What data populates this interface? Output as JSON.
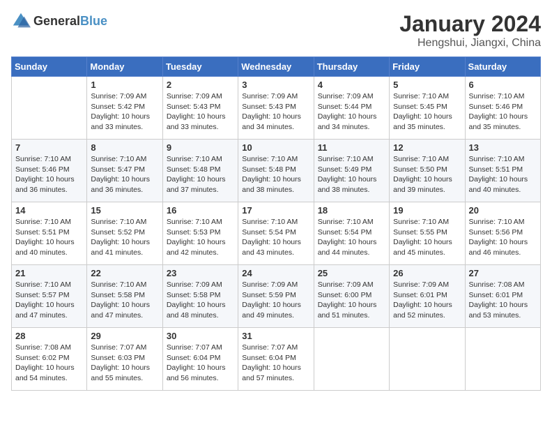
{
  "header": {
    "logo_general": "General",
    "logo_blue": "Blue",
    "title": "January 2024",
    "subtitle": "Hengshui, Jiangxi, China"
  },
  "calendar": {
    "days_of_week": [
      "Sunday",
      "Monday",
      "Tuesday",
      "Wednesday",
      "Thursday",
      "Friday",
      "Saturday"
    ],
    "weeks": [
      [
        {
          "day": "",
          "info": ""
        },
        {
          "day": "1",
          "info": "Sunrise: 7:09 AM\nSunset: 5:42 PM\nDaylight: 10 hours\nand 33 minutes."
        },
        {
          "day": "2",
          "info": "Sunrise: 7:09 AM\nSunset: 5:43 PM\nDaylight: 10 hours\nand 33 minutes."
        },
        {
          "day": "3",
          "info": "Sunrise: 7:09 AM\nSunset: 5:43 PM\nDaylight: 10 hours\nand 34 minutes."
        },
        {
          "day": "4",
          "info": "Sunrise: 7:09 AM\nSunset: 5:44 PM\nDaylight: 10 hours\nand 34 minutes."
        },
        {
          "day": "5",
          "info": "Sunrise: 7:10 AM\nSunset: 5:45 PM\nDaylight: 10 hours\nand 35 minutes."
        },
        {
          "day": "6",
          "info": "Sunrise: 7:10 AM\nSunset: 5:46 PM\nDaylight: 10 hours\nand 35 minutes."
        }
      ],
      [
        {
          "day": "7",
          "info": "Sunrise: 7:10 AM\nSunset: 5:46 PM\nDaylight: 10 hours\nand 36 minutes."
        },
        {
          "day": "8",
          "info": "Sunrise: 7:10 AM\nSunset: 5:47 PM\nDaylight: 10 hours\nand 36 minutes."
        },
        {
          "day": "9",
          "info": "Sunrise: 7:10 AM\nSunset: 5:48 PM\nDaylight: 10 hours\nand 37 minutes."
        },
        {
          "day": "10",
          "info": "Sunrise: 7:10 AM\nSunset: 5:48 PM\nDaylight: 10 hours\nand 38 minutes."
        },
        {
          "day": "11",
          "info": "Sunrise: 7:10 AM\nSunset: 5:49 PM\nDaylight: 10 hours\nand 38 minutes."
        },
        {
          "day": "12",
          "info": "Sunrise: 7:10 AM\nSunset: 5:50 PM\nDaylight: 10 hours\nand 39 minutes."
        },
        {
          "day": "13",
          "info": "Sunrise: 7:10 AM\nSunset: 5:51 PM\nDaylight: 10 hours\nand 40 minutes."
        }
      ],
      [
        {
          "day": "14",
          "info": "Sunrise: 7:10 AM\nSunset: 5:51 PM\nDaylight: 10 hours\nand 40 minutes."
        },
        {
          "day": "15",
          "info": "Sunrise: 7:10 AM\nSunset: 5:52 PM\nDaylight: 10 hours\nand 41 minutes."
        },
        {
          "day": "16",
          "info": "Sunrise: 7:10 AM\nSunset: 5:53 PM\nDaylight: 10 hours\nand 42 minutes."
        },
        {
          "day": "17",
          "info": "Sunrise: 7:10 AM\nSunset: 5:54 PM\nDaylight: 10 hours\nand 43 minutes."
        },
        {
          "day": "18",
          "info": "Sunrise: 7:10 AM\nSunset: 5:54 PM\nDaylight: 10 hours\nand 44 minutes."
        },
        {
          "day": "19",
          "info": "Sunrise: 7:10 AM\nSunset: 5:55 PM\nDaylight: 10 hours\nand 45 minutes."
        },
        {
          "day": "20",
          "info": "Sunrise: 7:10 AM\nSunset: 5:56 PM\nDaylight: 10 hours\nand 46 minutes."
        }
      ],
      [
        {
          "day": "21",
          "info": "Sunrise: 7:10 AM\nSunset: 5:57 PM\nDaylight: 10 hours\nand 47 minutes."
        },
        {
          "day": "22",
          "info": "Sunrise: 7:10 AM\nSunset: 5:58 PM\nDaylight: 10 hours\nand 47 minutes."
        },
        {
          "day": "23",
          "info": "Sunrise: 7:09 AM\nSunset: 5:58 PM\nDaylight: 10 hours\nand 48 minutes."
        },
        {
          "day": "24",
          "info": "Sunrise: 7:09 AM\nSunset: 5:59 PM\nDaylight: 10 hours\nand 49 minutes."
        },
        {
          "day": "25",
          "info": "Sunrise: 7:09 AM\nSunset: 6:00 PM\nDaylight: 10 hours\nand 51 minutes."
        },
        {
          "day": "26",
          "info": "Sunrise: 7:09 AM\nSunset: 6:01 PM\nDaylight: 10 hours\nand 52 minutes."
        },
        {
          "day": "27",
          "info": "Sunrise: 7:08 AM\nSunset: 6:01 PM\nDaylight: 10 hours\nand 53 minutes."
        }
      ],
      [
        {
          "day": "28",
          "info": "Sunrise: 7:08 AM\nSunset: 6:02 PM\nDaylight: 10 hours\nand 54 minutes."
        },
        {
          "day": "29",
          "info": "Sunrise: 7:07 AM\nSunset: 6:03 PM\nDaylight: 10 hours\nand 55 minutes."
        },
        {
          "day": "30",
          "info": "Sunrise: 7:07 AM\nSunset: 6:04 PM\nDaylight: 10 hours\nand 56 minutes."
        },
        {
          "day": "31",
          "info": "Sunrise: 7:07 AM\nSunset: 6:04 PM\nDaylight: 10 hours\nand 57 minutes."
        },
        {
          "day": "",
          "info": ""
        },
        {
          "day": "",
          "info": ""
        },
        {
          "day": "",
          "info": ""
        }
      ]
    ]
  }
}
